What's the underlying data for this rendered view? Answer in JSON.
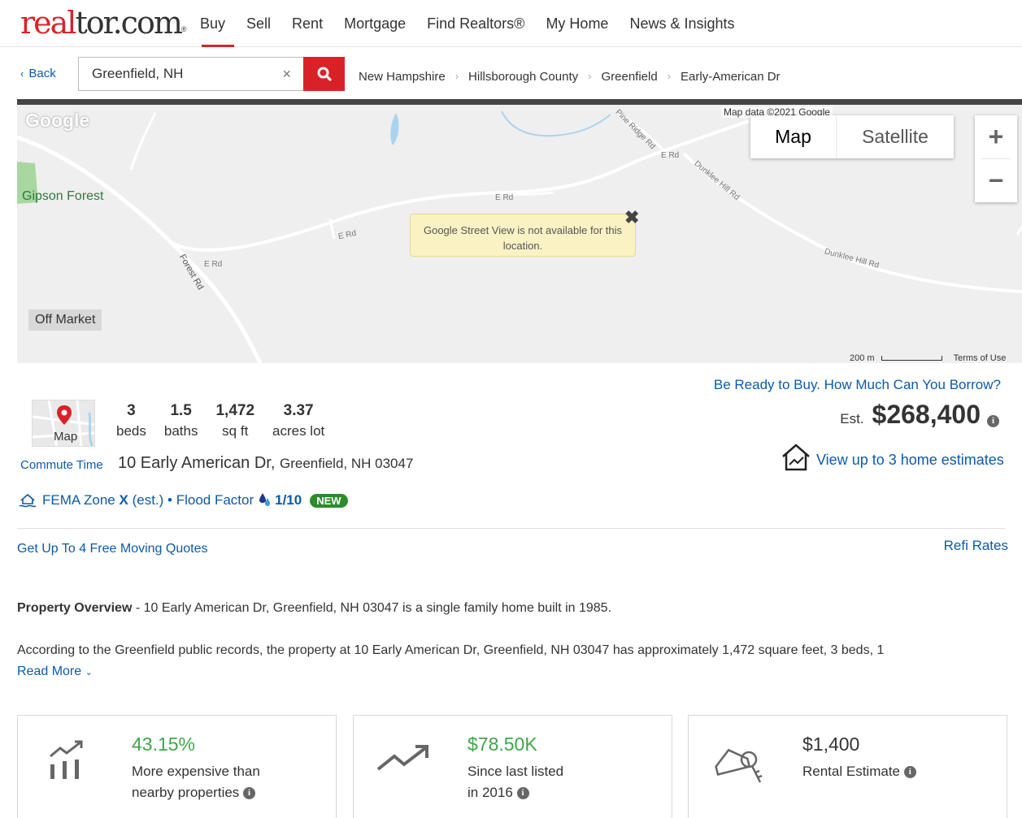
{
  "logo": {
    "part1": "real",
    "part2": "tor.com",
    "mark": "®"
  },
  "nav": {
    "items": [
      "Buy",
      "Sell",
      "Rent",
      "Mortgage",
      "Find Realtors®",
      "My Home",
      "News & Insights"
    ]
  },
  "search": {
    "back_label": "Back",
    "value": "Greenfield, NH",
    "clear": "×"
  },
  "breadcrumb": [
    "New Hampshire",
    "Hillsborough County",
    "Greenfield",
    "Early-American Dr"
  ],
  "map": {
    "google_logo": "Google",
    "map_data": "Map data ©2021 Google",
    "toggle_map": "Map",
    "toggle_satellite": "Satellite",
    "zoom_in": "+",
    "zoom_out": "−",
    "street_view_msg": "Google Street View is not available for this location.",
    "off_market": "Off Market",
    "forest_label": "Gipson Forest",
    "scale_label": "200 m",
    "terms": "Terms of Use",
    "road_labels": [
      "E Rd",
      "E Rd",
      "E Rd",
      "E Rd",
      "Forest Rd",
      "Pine Ridge Rd",
      "Dunklee Hill Rd",
      "Dunklee Hill Rd"
    ]
  },
  "details": {
    "be_ready": "Be Ready to Buy. How Much Can You Borrow?",
    "minimap_label": "Map",
    "stats": [
      {
        "value": "3",
        "label": "beds"
      },
      {
        "value": "1.5",
        "label": "baths"
      },
      {
        "value": "1,472",
        "label": "sq ft"
      },
      {
        "value": "3.37",
        "label": "acres lot"
      }
    ],
    "est_label": "Est.",
    "est_price": "$268,400",
    "commute": "Commute Time",
    "address_street": "10 Early American Dr,",
    "address_city": "Greenfield, NH 03047",
    "view_estimates": "View up to 3 home estimates",
    "fema_prefix": "FEMA Zone",
    "fema_zone": "X",
    "fema_suffix": "(est.) • Flood Factor",
    "flood_score": "1/10",
    "new_badge": "NEW",
    "moving_quotes": "Get Up To 4 Free Moving Quotes",
    "refi_rates": "Refi Rates"
  },
  "overview": {
    "title": "Property Overview",
    "text": " - 10 Early American Dr, Greenfield, NH 03047 is a single family home built in 1985.",
    "according": "According to the Greenfield public records, the property at 10 Early American Dr, Greenfield, NH 03047 has approximately 1,472 square feet, 3 beds, 1",
    "read_more": "Read More"
  },
  "cards": [
    {
      "big": "43.15%",
      "line1": "More expensive than",
      "line2": "nearby properties"
    },
    {
      "big": "$78.50K",
      "line1": "Since last listed",
      "line2": "in 2016"
    },
    {
      "big": "$1,400",
      "line1": "Rental Estimate",
      "line2": ""
    }
  ],
  "colors": {
    "brand_red": "#d92228",
    "link_blue": "#0b5aab",
    "positive_green": "#3fa54a"
  }
}
